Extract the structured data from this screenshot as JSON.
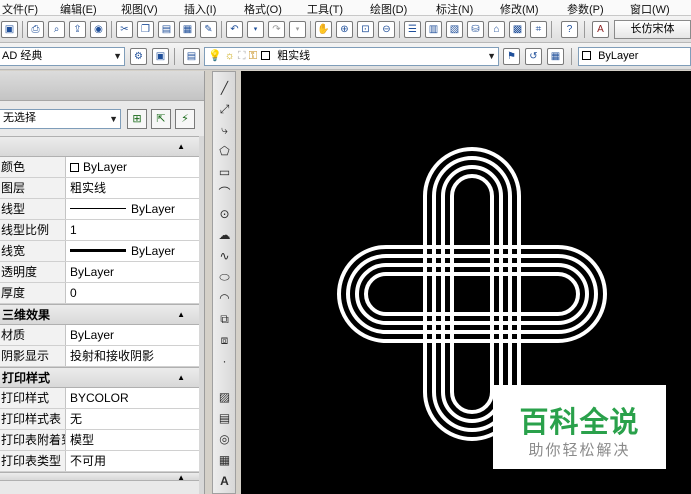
{
  "menu": {
    "items": [
      "文件(F)",
      "编辑(E)",
      "视图(V)",
      "插入(I)",
      "格式(O)",
      "工具(T)",
      "绘图(D)",
      "标注(N)",
      "修改(M)",
      "参数(P)",
      "窗口(W)"
    ]
  },
  "toolbar1": {
    "font_name": "长仿宋体"
  },
  "toolbar2": {
    "workspace": "AD 经典",
    "layer": "粗实线",
    "color": "ByLayer"
  },
  "palette": {
    "selection": "无选择",
    "categories": [
      {
        "name": "",
        "rows": [
          {
            "key": "颜色",
            "value": "ByLayer"
          },
          {
            "key": "图层",
            "value": "粗实线"
          },
          {
            "key": "线型",
            "value": "ByLayer"
          },
          {
            "key": "线型比例",
            "value": "1"
          },
          {
            "key": "线宽",
            "value": "ByLayer"
          },
          {
            "key": "透明度",
            "value": "ByLayer"
          },
          {
            "key": "厚度",
            "value": "0"
          }
        ]
      },
      {
        "name": "三维效果",
        "rows": [
          {
            "key": "材质",
            "value": "ByLayer"
          },
          {
            "key": "阴影显示",
            "value": "投射和接收阴影"
          }
        ]
      },
      {
        "name": "打印样式",
        "rows": [
          {
            "key": "打印样式",
            "value": "BYCOLOR"
          },
          {
            "key": "打印样式表",
            "value": "无"
          },
          {
            "key": "打印表附着到",
            "value": "模型"
          },
          {
            "key": "打印表类型",
            "value": "不可用"
          }
        ]
      }
    ]
  },
  "watermark": {
    "title": "百科全说",
    "subtitle": "助你轻松解决"
  },
  "colors": {
    "canvas": "#000000",
    "stroke": "#ffffff",
    "watermark_green": "#2aa14b"
  }
}
